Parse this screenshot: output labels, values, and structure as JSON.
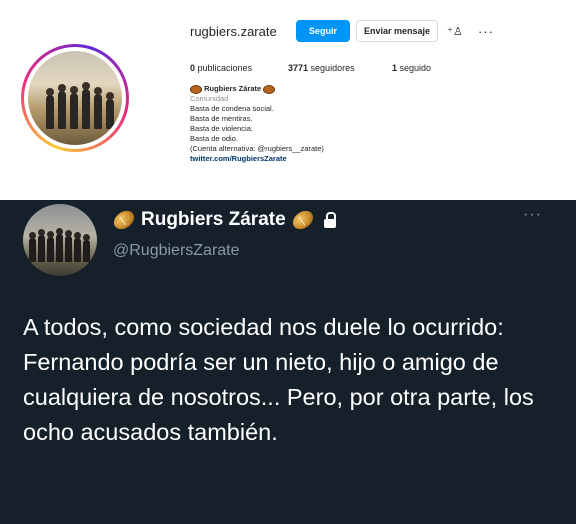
{
  "instagram": {
    "username": "rugbiers.zarate",
    "follow_label": "Seguir",
    "message_label": "Enviar mensaje",
    "suggest_icon": "person-add-icon",
    "more_icon": "ellipsis-icon",
    "stats": {
      "posts": "0",
      "posts_label": "publicaciones",
      "followers": "3771",
      "followers_label": "seguidores",
      "following": "1",
      "following_label": "seguido"
    },
    "bio": {
      "display_name": "Rugbiers Zárate",
      "category": "Comunidad",
      "lines": [
        "Basta de condena social.",
        "Basta de mentiras.",
        "Basta de violencia.",
        "Basta de odio.",
        "(Cuenta alternativa: @rugbiers__zarate)"
      ],
      "link": "twitter.com/RugbiersZarate"
    }
  },
  "twitter": {
    "display_name": "Rugbiers Zárate",
    "handle": "@RugbiersZarate",
    "more_icon": "ellipsis-icon",
    "tweet_text": "A todos, como sociedad nos duele lo ocurrido: Fernando podría ser un nieto, hijo o amigo de cualquiera de nosotros... Pero, por otra parte, los ocho acusados también."
  },
  "colors": {
    "follow_blue": "#0095f6",
    "twitter_bg": "#15202b",
    "twitter_secondary": "#8b98a5"
  }
}
